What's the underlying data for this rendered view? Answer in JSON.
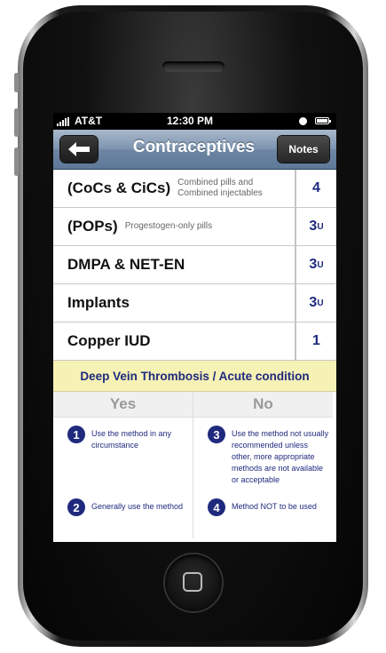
{
  "status_bar": {
    "carrier": "AT&T",
    "time": "12:30 PM"
  },
  "nav": {
    "title": "Contraceptives",
    "notes_label": "Notes",
    "back_icon": "back-arrow-icon"
  },
  "methods": [
    {
      "name": "(CoCs & CiCs)",
      "desc": "Combined pills and Combined injectables",
      "category": "4",
      "sup": ""
    },
    {
      "name": "(POPs)",
      "desc": "Progestogen-only pills",
      "category": "3",
      "sup": "U"
    },
    {
      "name": "DMPA & NET-EN",
      "desc": "",
      "category": "3",
      "sup": "U"
    },
    {
      "name": "Implants",
      "desc": "",
      "category": "3",
      "sup": "U"
    },
    {
      "name": "Copper IUD",
      "desc": "",
      "category": "1",
      "sup": ""
    }
  ],
  "condition": "Deep Vein Thrombosis / Acute condition",
  "legend": {
    "yes_label": "Yes",
    "no_label": "No",
    "items": [
      {
        "num": "1",
        "text": "Use the method in any circumstance"
      },
      {
        "num": "2",
        "text": "Generally use the method"
      },
      {
        "num": "3",
        "text": "Use the method not usually recommended unless other, more appropriate methods are not available or acceptable"
      },
      {
        "num": "4",
        "text": "Method NOT to be used"
      }
    ]
  },
  "colors": {
    "category_text": "#1f2a7e",
    "condition_bg": "#f6f1b5",
    "nav_bar": "#7c93ae"
  }
}
